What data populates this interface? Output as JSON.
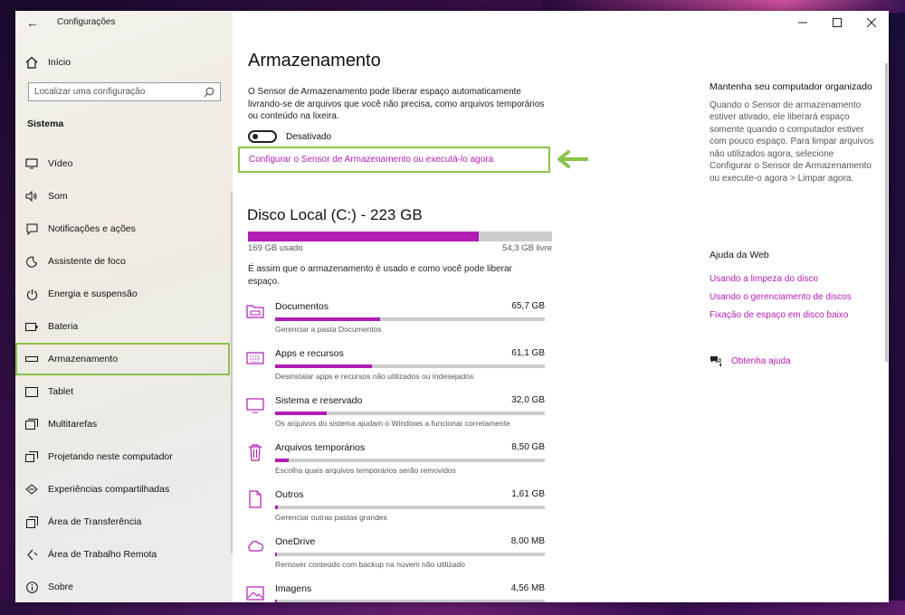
{
  "window": {
    "title": "Configurações",
    "back_icon": "back-arrow-icon",
    "caption_buttons": [
      "minimize",
      "maximize",
      "close"
    ]
  },
  "sidebar": {
    "home_label": "Início",
    "search_placeholder": "Localizar uma configuração",
    "section_title": "Sistema",
    "items": [
      {
        "label": "Vídeo",
        "icon": "display-icon"
      },
      {
        "label": "Som",
        "icon": "speaker-icon"
      },
      {
        "label": "Notificações e ações",
        "icon": "notifications-icon"
      },
      {
        "label": "Assistente de foco",
        "icon": "focus-assist-icon"
      },
      {
        "label": "Energia e suspensão",
        "icon": "power-icon"
      },
      {
        "label": "Bateria",
        "icon": "battery-icon"
      },
      {
        "label": "Armazenamento",
        "icon": "storage-icon",
        "active": true
      },
      {
        "label": "Tablet",
        "icon": "tablet-icon"
      },
      {
        "label": "Multitarefas",
        "icon": "multitasking-icon"
      },
      {
        "label": "Projetando neste computador",
        "icon": "projecting-icon"
      },
      {
        "label": "Experiências compartilhadas",
        "icon": "shared-experiences-icon"
      },
      {
        "label": "Área de Transferência",
        "icon": "clipboard-icon"
      },
      {
        "label": "Área de Trabalho Remota",
        "icon": "remote-desktop-icon"
      },
      {
        "label": "Sobre",
        "icon": "info-icon"
      }
    ]
  },
  "main": {
    "title": "Armazenamento",
    "description": "O Sensor de Armazenamento pode liberar espaço automaticamente livrando-se de arquivos que você não precisa, como arquivos temporários ou conteúdo na lixeira.",
    "toggle_state": "Desativado",
    "configure_link": "Configurar o Sensor de Armazenamento ou executá-lo agora",
    "disk": {
      "title": "Disco Local (C:) - 223 GB",
      "used_label": "169 GB usado",
      "free_label": "54,3 GB livre",
      "used_fraction": 0.758
    },
    "usage_note": "É assim que o armazenamento é usado e como você pode liberar espaço.",
    "categories": [
      {
        "name": "Documentos",
        "size": "65,7 GB",
        "desc": "Gerenciar a pasta Documentos",
        "fraction": 0.39,
        "icon": "documents-icon"
      },
      {
        "name": "Apps e recursos",
        "size": "61,1 GB",
        "desc": "Desinstalar apps e recursos não utilizados ou indesejados",
        "fraction": 0.36,
        "icon": "apps-icon"
      },
      {
        "name": "Sistema e reservado",
        "size": "32,0 GB",
        "desc": "Os arquivos do sistema ajudam o Windows a funcionar corretamente",
        "fraction": 0.19,
        "icon": "system-icon"
      },
      {
        "name": "Arquivos temporários",
        "size": "8,50 GB",
        "desc": "Escolha quais arquivos temporários serão removidos",
        "fraction": 0.05,
        "icon": "trash-icon"
      },
      {
        "name": "Outros",
        "size": "1,61 GB",
        "desc": "Gerenciar outras pastas grandes",
        "fraction": 0.01,
        "icon": "other-files-icon"
      },
      {
        "name": "OneDrive",
        "size": "8,00 MB",
        "desc": "Remover conteúdo com backup na nuvem não utilizado",
        "fraction": 0.004,
        "icon": "onedrive-icon"
      },
      {
        "name": "Imagens",
        "size": "4,56 MB",
        "desc": "",
        "fraction": 0.003,
        "icon": "images-icon"
      }
    ]
  },
  "right": {
    "title": "Mantenha seu computador organizado",
    "text": "Quando o Sensor de armazenamento estiver ativado, ele liberará espaço somente quando o computador estiver com pouco espaço. Para limpar arquivos não utilizados agora, selecione Configurar o Sensor de Armazenamento ou execute-o agora > Limpar agora.",
    "web_help_title": "Ajuda da Web",
    "links": [
      "Usando a limpeza do disco",
      "Usando o gerenciamento de discos",
      "Fixação de espaço em disco baixo"
    ],
    "get_help": "Obtenha ajuda"
  },
  "colors": {
    "accent": "#b11cb5",
    "highlight": "#8bc34a",
    "bar_bg": "#cccccc"
  }
}
